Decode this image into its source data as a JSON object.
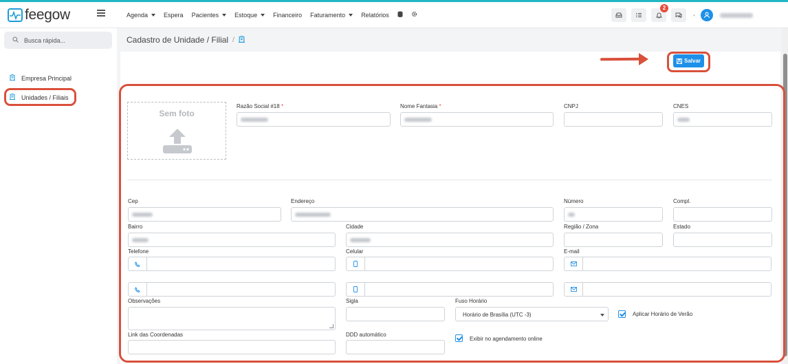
{
  "brand": {
    "name": "feegow"
  },
  "nav": {
    "items": [
      {
        "label": "Agenda",
        "dropdown": true
      },
      {
        "label": "Espera",
        "dropdown": false
      },
      {
        "label": "Pacientes",
        "dropdown": true
      },
      {
        "label": "Estoque",
        "dropdown": true
      },
      {
        "label": "Financeiro",
        "dropdown": false
      },
      {
        "label": "Faturamento",
        "dropdown": true
      },
      {
        "label": "Relatórios",
        "dropdown": false
      }
    ],
    "icons": [
      "database-icon",
      "gear-icon"
    ]
  },
  "topbar": {
    "notification_count": "2"
  },
  "sidebar": {
    "search_placeholder": "Busca rápida...",
    "items": [
      {
        "label": "Empresa Principal",
        "icon": "building-icon"
      },
      {
        "label": "Unidades / Filiais",
        "icon": "building-icon"
      }
    ]
  },
  "page": {
    "title": "Cadastro de Unidade / Filial",
    "separator": "/"
  },
  "toolbar": {
    "save_label": "Salvar"
  },
  "form": {
    "photo_label": "Sem foto",
    "razao_social": {
      "label": "Razão Social #18",
      "required_mark": "*"
    },
    "nome_fantasia": {
      "label": "Nome Fantasia",
      "required_mark": "*"
    },
    "cnpj": {
      "label": "CNPJ"
    },
    "cnes": {
      "label": "CNES"
    },
    "cep": {
      "label": "Cep"
    },
    "endereco": {
      "label": "Endereço"
    },
    "numero": {
      "label": "Número"
    },
    "compl": {
      "label": "Compl."
    },
    "bairro": {
      "label": "Bairro"
    },
    "cidade": {
      "label": "Cidade"
    },
    "regiao": {
      "label": "Região / Zona"
    },
    "estado": {
      "label": "Estado"
    },
    "telefone": {
      "label": "Telefone"
    },
    "celular": {
      "label": "Celular"
    },
    "email": {
      "label": "E-mail"
    },
    "observacoes": {
      "label": "Observações"
    },
    "sigla": {
      "label": "Sigla"
    },
    "fuso": {
      "label": "Fuso Horário",
      "value": "Horário de Brasília (UTC -3)"
    },
    "horario_verao": {
      "label": "Aplicar Horário de Verão",
      "checked": true
    },
    "link_coordenadas": {
      "label": "Link das Coordenadas"
    },
    "ddd": {
      "label": "DDD automático"
    },
    "exibir_agendamento": {
      "label": "Exibir no agendamento online",
      "checked": true
    }
  },
  "colors": {
    "accent": "#1e90e8",
    "highlight": "#d9503b",
    "brand": "#1e9bd7"
  }
}
